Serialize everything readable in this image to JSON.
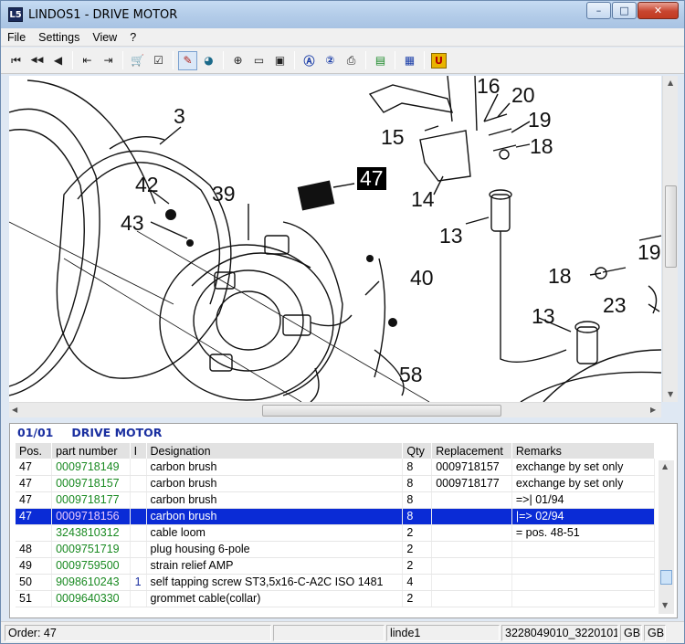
{
  "window": {
    "title": "LINDOS1 - DRIVE MOTOR",
    "app_icon_glyph": "L5",
    "controls": {
      "minimize": "–",
      "maximize": "□",
      "close": "✕"
    }
  },
  "menu": [
    "File",
    "Settings",
    "View",
    "?"
  ],
  "toolbar": [
    {
      "name": "first-icon",
      "glyph": "⏮"
    },
    {
      "name": "previous-fast-icon",
      "glyph": "◀◀"
    },
    {
      "name": "previous-icon",
      "glyph": "◀"
    },
    {
      "name": "back-page-icon",
      "glyph": "⇤"
    },
    {
      "name": "forward-page-icon",
      "glyph": "⇥"
    },
    {
      "name": "cart-icon",
      "glyph": "🛒"
    },
    {
      "name": "order-list-icon",
      "glyph": "☑"
    },
    {
      "name": "parts-tag-icon",
      "glyph": "✎"
    },
    {
      "name": "globe-icon",
      "glyph": "◕"
    },
    {
      "name": "zoom-icon",
      "glyph": "⊕"
    },
    {
      "name": "page-icon",
      "glyph": "▭"
    },
    {
      "name": "page-fit-icon",
      "glyph": "▣"
    },
    {
      "name": "info-a-icon",
      "glyph": "Ⓐ"
    },
    {
      "name": "info-2-icon",
      "glyph": "②"
    },
    {
      "name": "print-icon",
      "glyph": "⎙"
    },
    {
      "name": "book-icon",
      "glyph": "▤"
    },
    {
      "name": "grid-icon",
      "glyph": "▦"
    },
    {
      "name": "u-icon",
      "glyph": "U"
    }
  ],
  "drawing": {
    "callouts": [
      "3",
      "42",
      "43",
      "39",
      "47",
      "15",
      "16",
      "20",
      "19",
      "18",
      "14",
      "13",
      "40",
      "58",
      "18",
      "13",
      "23",
      "19"
    ]
  },
  "parts": {
    "section": "01/01",
    "title": "DRIVE MOTOR",
    "columns": [
      "Pos.",
      "part number",
      "I",
      "Designation",
      "Qty",
      "Replacement",
      "Remarks"
    ],
    "rows": [
      {
        "pos": "47",
        "part": "0009718149",
        "info": "",
        "designation": "carbon brush",
        "qty": "8",
        "replacement": "0009718157",
        "remarks": "exchange by set only",
        "selected": false
      },
      {
        "pos": "47",
        "part": "0009718157",
        "info": "",
        "designation": "carbon brush",
        "qty": "8",
        "replacement": "0009718177",
        "remarks": "exchange by set only",
        "selected": false
      },
      {
        "pos": "47",
        "part": "0009718177",
        "info": "",
        "designation": "carbon brush",
        "qty": "8",
        "replacement": "",
        "remarks": "=>| 01/94",
        "selected": false
      },
      {
        "pos": "47",
        "part": "0009718156",
        "info": "",
        "designation": "carbon brush",
        "qty": "8",
        "replacement": "",
        "remarks": "|=> 02/94",
        "selected": true
      },
      {
        "pos": "",
        "part": "3243810312",
        "info": "",
        "designation": "cable loom",
        "qty": "2",
        "replacement": "",
        "remarks": "= pos. 48-51",
        "selected": false
      },
      {
        "pos": "48",
        "part": "0009751719",
        "info": "",
        "designation": "plug housing 6-pole",
        "qty": "2",
        "replacement": "",
        "remarks": "",
        "selected": false
      },
      {
        "pos": "49",
        "part": "0009759500",
        "info": "",
        "designation": "strain relief AMP",
        "qty": "2",
        "replacement": "",
        "remarks": "",
        "selected": false
      },
      {
        "pos": "50",
        "part": "9098610243",
        "info": "1",
        "designation": "self tapping screw ST3,5x16-C-A2C  ISO 1481",
        "qty": "4",
        "replacement": "",
        "remarks": "",
        "selected": false
      },
      {
        "pos": "51",
        "part": "0009640330",
        "info": "",
        "designation": "grommet cable(collar)",
        "qty": "2",
        "replacement": "",
        "remarks": "",
        "selected": false
      }
    ]
  },
  "status": {
    "order": "Order: 47",
    "empty": "",
    "user": "linde1",
    "code": "3228049010_3220101",
    "lang1": "GB",
    "lang2": "GB"
  },
  "colors": {
    "selection": "#0a2bd6",
    "part_number": "#1a8a22",
    "header_text": "#1a2fa0"
  }
}
